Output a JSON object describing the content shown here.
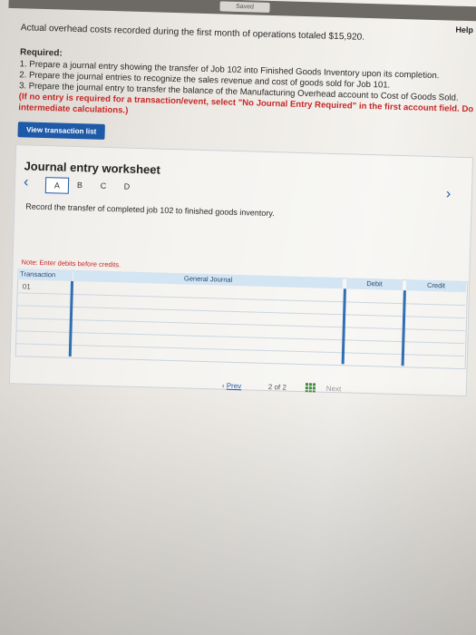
{
  "topbar": {
    "saved_label": "Saved"
  },
  "help_label": "Help",
  "intro_text": "Actual overhead costs recorded during the first month of operations totaled $15,920.",
  "required": {
    "heading": "Required:",
    "items": [
      "1. Prepare a journal entry showing the transfer of Job 102 into Finished Goods Inventory upon its completion.",
      "2. Prepare the journal entries to recognize the sales revenue and cost of goods sold for Job 101.",
      "3. Prepare the journal entry to transfer the balance of the Manufacturing Overhead account to Cost of Goods Sold."
    ],
    "note_line1": "(If no entry is required for a transaction/event, select \"No Journal Entry Required\" in the first account field. Do not round your",
    "note_line2": "intermediate calculations.)"
  },
  "view_transaction_list_label": "View transaction list",
  "worksheet": {
    "title": "Journal entry worksheet",
    "tabs": [
      "A",
      "B",
      "C",
      "D"
    ],
    "active_tab": "A",
    "instruction": "Record the transfer of completed job 102 to finished goods inventory.",
    "note": "Note: Enter debits before credits.",
    "columns": [
      "Transaction",
      "General Journal",
      "Debit",
      "Credit"
    ],
    "rows": [
      {
        "transaction": "01"
      }
    ]
  },
  "pagination": {
    "prev_label": "Prev",
    "page_text": "2 of 2",
    "next_label": "Next"
  }
}
